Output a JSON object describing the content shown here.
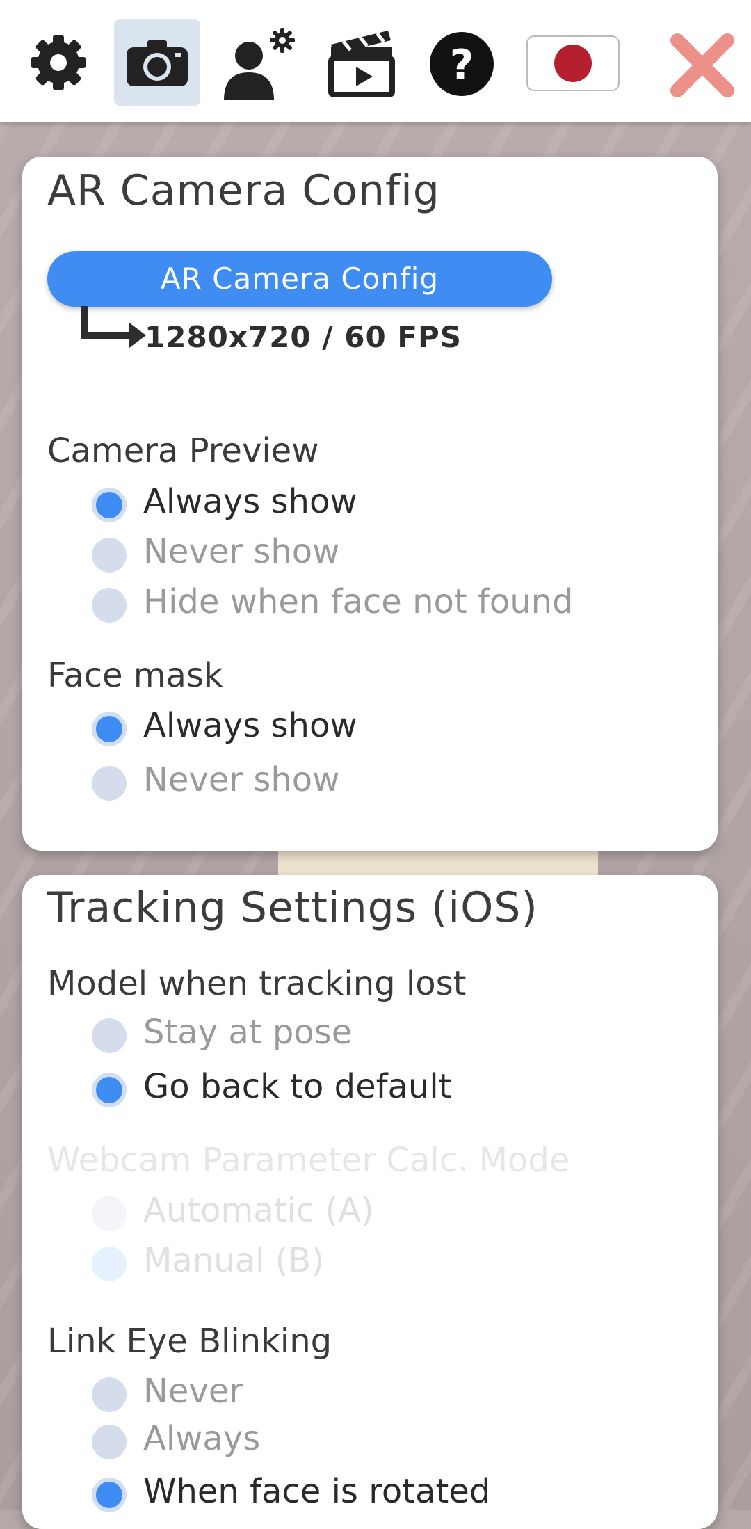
{
  "toolbar": {
    "buttons": [
      {
        "name": "settings",
        "icon": "gear-icon"
      },
      {
        "name": "camera",
        "icon": "camera-icon",
        "active": true
      },
      {
        "name": "avatar-settings",
        "icon": "person-gear-icon"
      },
      {
        "name": "recording",
        "icon": "clapperboard-icon"
      },
      {
        "name": "help",
        "icon": "question-circle-icon"
      },
      {
        "name": "language",
        "icon": "japan-flag-icon"
      },
      {
        "name": "close",
        "icon": "close-x-icon"
      }
    ],
    "colors": {
      "active_bg": "#d9e4ef",
      "close": "#ec908a",
      "flag_red": "#b5202e"
    }
  },
  "ar_camera": {
    "title": "AR Camera Config",
    "button_label": "AR Camera Config",
    "current_value": "1280x720 / 60 FPS",
    "camera_preview": {
      "label": "Camera Preview",
      "options": [
        "Always show",
        "Never show",
        "Hide when face not found"
      ],
      "selected": "Always show"
    },
    "face_mask": {
      "label": "Face mask",
      "options": [
        "Always show",
        "Never show"
      ],
      "selected": "Always show"
    }
  },
  "tracking": {
    "title": "Tracking Settings (iOS)",
    "model_lost": {
      "label": "Model when tracking lost",
      "options": [
        "Stay at pose",
        "Go back to default"
      ],
      "selected": "Go back to default"
    },
    "webcam_mode": {
      "label": "Webcam Parameter Calc. Mode",
      "options": [
        "Automatic (A)",
        "Manual (B)"
      ],
      "selected": "Manual (B)",
      "disabled": true
    },
    "eye_blink": {
      "label": "Link Eye Blinking",
      "options": [
        "Never",
        "Always",
        "When face is rotated"
      ],
      "selected": "When face is rotated"
    }
  },
  "theme": {
    "accent": "#3f8cf2",
    "radio_off": "#d5dcec"
  }
}
